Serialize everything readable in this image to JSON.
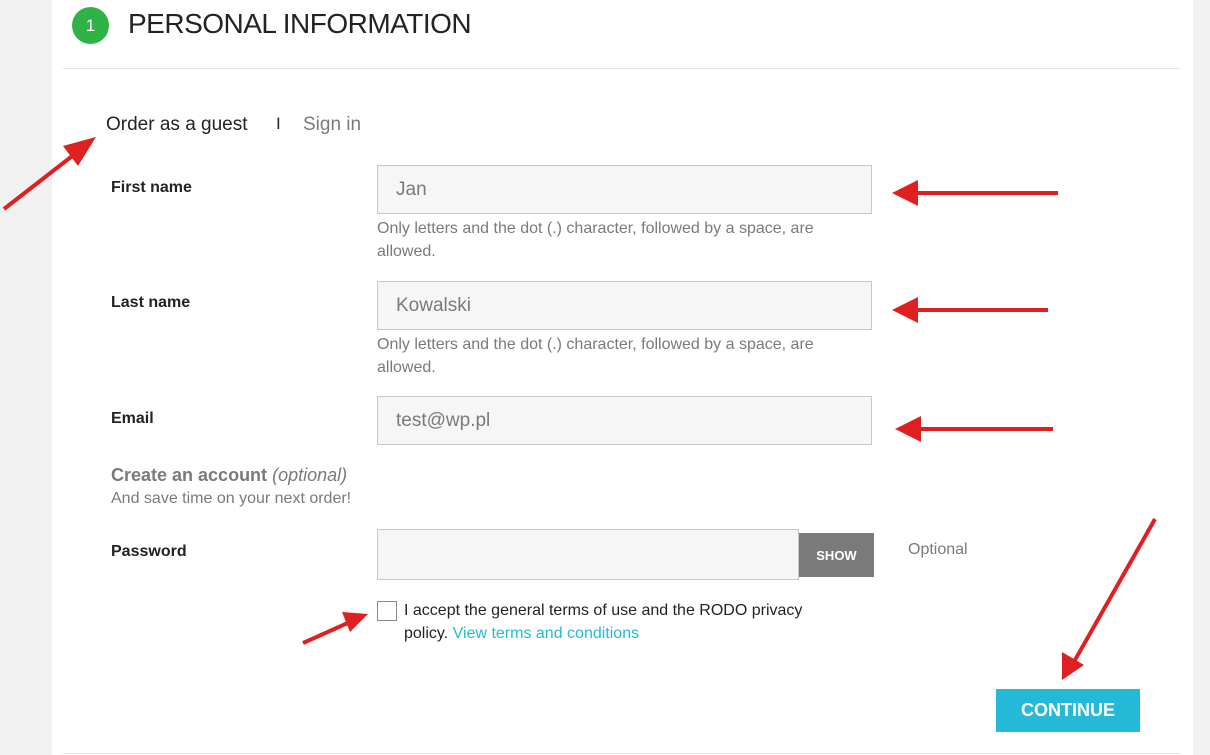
{
  "section": {
    "step_number": "1",
    "title": "PERSONAL INFORMATION"
  },
  "tabs": {
    "guest": "Order as a guest",
    "separator": "I",
    "signin": "Sign in"
  },
  "form": {
    "first_name": {
      "label": "First name",
      "value": "Jan",
      "hint": "Only letters and the dot (.) character, followed by a space, are allowed."
    },
    "last_name": {
      "label": "Last name",
      "value": "Kowalski",
      "hint": "Only letters and the dot (.) character, followed by a space, are allowed."
    },
    "email": {
      "label": "Email",
      "value": "test@wp.pl"
    },
    "create_account": {
      "title": "Create an account",
      "optional": "(optional)",
      "subtitle": "And save time on your next order!"
    },
    "password": {
      "label": "Password",
      "value": "",
      "show_label": "SHOW",
      "note": "Optional"
    },
    "terms": {
      "text": "I accept the general terms of use and the RODO privacy policy.",
      "link": "View terms and conditions",
      "checked": false
    }
  },
  "continue_label": "CONTINUE",
  "colors": {
    "accent": "#24b9d7",
    "step_badge": "#2fb347",
    "annotation_arrow": "#e02020"
  }
}
